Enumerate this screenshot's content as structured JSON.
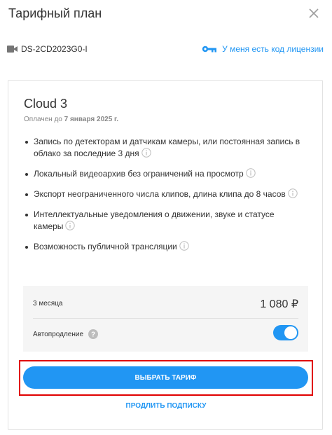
{
  "header": {
    "title": "Тарифный план",
    "close_icon": "close-icon"
  },
  "device": {
    "camera_icon": "camera-icon",
    "id": "DS-2CD2023G0-I"
  },
  "license": {
    "icon": "key-icon",
    "label": "У меня есть код лицензии"
  },
  "plan": {
    "name": "Cloud 3",
    "paid_prefix": "Оплачен до",
    "paid_date": "7 января 2025 г.",
    "features": [
      "Запись по детекторам и датчикам камеры, или постоянная запись в облако за последние 3 дня",
      "Локальный видеоархив без ограничений на просмотр",
      "Экспорт неограниченного числа клипов, длина клипа до 8 часов",
      "Интеллектуальные уведомления о движении, звуке и статусе камеры",
      "Возможность публичной трансляции"
    ]
  },
  "pricing": {
    "period": "3 месяца",
    "price": "1 080 ₽",
    "autorenew_label": "Автопродление",
    "autorenew_on": true
  },
  "actions": {
    "select_label": "ВЫБРАТЬ ТАРИФ",
    "renew_label": "ПРОДЛИТЬ ПОДПИСКУ"
  },
  "colors": {
    "accent": "#2196f3",
    "highlight": "#e00000"
  }
}
